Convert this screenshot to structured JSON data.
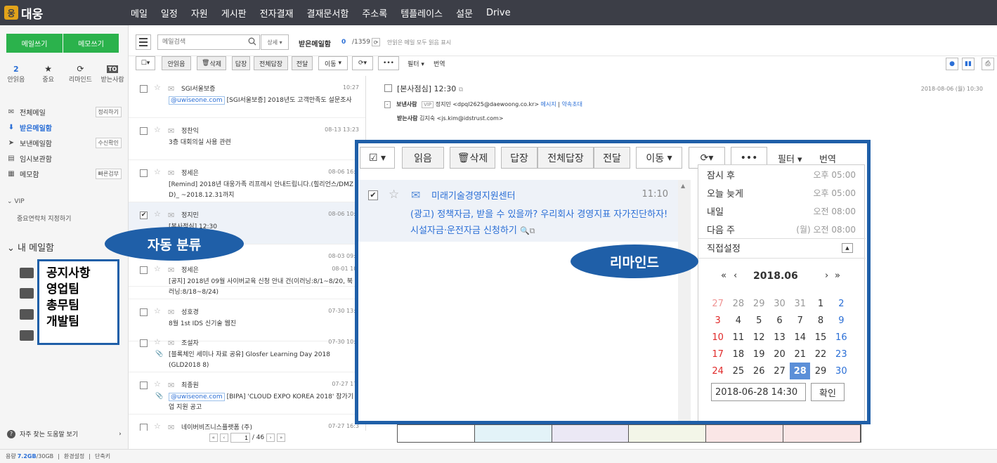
{
  "brand": {
    "logo_mark": "웅",
    "name": "대웅"
  },
  "topnav": [
    "메일",
    "일정",
    "자원",
    "게시판",
    "전자결재",
    "결재문서함",
    "주소록",
    "템플레이스",
    "설문",
    "Drive"
  ],
  "sidebar": {
    "compose": "메일쓰기",
    "memo": "메모쓰기",
    "quick": [
      {
        "top": "2",
        "label": "안읽음"
      },
      {
        "top": "★",
        "label": "중요"
      },
      {
        "top": "⟳",
        "label": "리마인드"
      },
      {
        "top": "TO",
        "label": "받는사람"
      }
    ],
    "folders": [
      {
        "label": "전체메일",
        "icon": "✉",
        "button": "정리하기"
      },
      {
        "label": "받은메일함",
        "icon": "⬇",
        "button": ""
      },
      {
        "label": "보낸메일함",
        "icon": "➤",
        "button": "수신확인"
      },
      {
        "label": "임시보관함",
        "icon": "▤",
        "button": ""
      },
      {
        "label": "메모함",
        "icon": "▦",
        "button": "빠른검부"
      }
    ],
    "vip": "VIP",
    "vip_sub": "중요연락처 지정하기",
    "mybox": "내 메일함",
    "teams": [
      "공지사항",
      "영업팀",
      "총무팀",
      "개발팀"
    ],
    "help": "자주 찾는 도움말 보기"
  },
  "status": {
    "label": "용량",
    "used": "7.2GB",
    "total": "/30GB",
    "settings": "환경설정",
    "shortcut": "단축키"
  },
  "search": {
    "placeholder": "메일검색",
    "detail": "상세",
    "inbox_title": "받은메일함",
    "count": "0",
    "total": "/1359",
    "read_all": "안읽은 메일 모두 읽음 표시"
  },
  "toolbar": {
    "read": "안읽음",
    "delete": "삭제",
    "reply": "답장",
    "reply_all": "전체답장",
    "forward": "전달",
    "move": "이동",
    "more": "•••",
    "filter": "필터",
    "translate": "번역"
  },
  "mails": [
    {
      "sender": "SGI서울보증",
      "date": "10:27",
      "tag": "@uwiseone.com",
      "subject": "[SGI서울보증] 2018년도 고객만족도 설문조사",
      "clip": false,
      "selected": false
    },
    {
      "sender": "정찬익",
      "date": "08-13 13:23",
      "tag": "",
      "subject": "3층 대회의실 사용 관련",
      "clip": false,
      "selected": false
    },
    {
      "sender": "정세은",
      "date": "08-06 16:2",
      "tag": "",
      "subject": "[Remind] 2018년 대웅가족 리프레시 안내드립니다.(힐리언스/DMZ D)_ ~2018.12.31까지",
      "clip": false,
      "selected": false
    },
    {
      "sender": "정지민",
      "date": "08-06 10:3",
      "tag": "",
      "subject": "[본사점심] 12:30",
      "clip": false,
      "selected": true
    },
    {
      "sender": "",
      "date": "08-03 09:3",
      "tag": "",
      "subject": "",
      "clip": false,
      "selected": false
    },
    {
      "sender": "정세은",
      "date": "08-01 10:",
      "tag": "",
      "subject": "[공지] 2018년 09월 사이버교육 신청 안내 건(이러닝:8/1~8/20, 북러닝:8/18~8/24)",
      "clip": false,
      "selected": false
    },
    {
      "sender": "성호경",
      "date": "07-30 13:4",
      "tag": "",
      "subject": "8월 1st IDS 신기술 웹진",
      "clip": false,
      "selected": false
    },
    {
      "sender": "조설자",
      "date": "07-30 10:4",
      "tag": "",
      "subject": "[블록체인 세미나 자료 공유] Glosfer Learning Day 2018 (GLD2018 8)",
      "clip": true,
      "selected": false
    },
    {
      "sender": "최종원",
      "date": "07-27 17:",
      "tag": "@uwiseone.com",
      "subject": "[BIPA] 'CLOUD EXPO KOREA 2018' 참가기업 지원 공고",
      "clip": true,
      "selected": false
    },
    {
      "sender": "네이버비즈니스플랫폼 (주)",
      "date": "07-27 16:3",
      "tag": "",
      "subject": "",
      "clip": false,
      "selected": false
    }
  ],
  "pager": {
    "current": "1",
    "total": "/ 46"
  },
  "reading": {
    "subject": "[본사점심] 12:30",
    "date": "2018-08-06 (월) 10:30",
    "from_label": "보낸사람",
    "vip": "VIP",
    "from": "정지민 <dpql2625@daewoong.co.kr>",
    "from_link1": "메시지",
    "from_link2": "약속초대",
    "to_label": "받는사람",
    "to": "김지숙 <js.kim@idstrust.com>"
  },
  "zoom": {
    "read": "읽음",
    "delete": "삭제",
    "reply": "답장",
    "reply_all": "전체답장",
    "forward": "전달",
    "move": "이동",
    "more": "•••",
    "filter": "필터",
    "translate": "번역",
    "mail_sender": "미래기술경영지원센터",
    "mail_time": "11:10",
    "mail_subject": "(광고) 정책자금, 받을 수 있을까? 우리회사 경영지표 자가진단하자! 시설자금·운전자금 신청하기"
  },
  "remind": {
    "options": [
      {
        "label": "잠시 후",
        "time": "오후 05:00"
      },
      {
        "label": "오늘 늦게",
        "time": "오후 05:00"
      },
      {
        "label": "내일",
        "time": "오전 08:00"
      },
      {
        "label": "다음 주",
        "time": "(월) 오전 08:00"
      }
    ],
    "custom": "직접설정",
    "cal_title": "2018.06",
    "cal_prev2": "«",
    "cal_prev": "‹",
    "cal_next": "›",
    "cal_next2": "»",
    "weeks": [
      [
        "27",
        "28",
        "29",
        "30",
        "31",
        "1",
        "2"
      ],
      [
        "3",
        "4",
        "5",
        "6",
        "7",
        "8",
        "9"
      ],
      [
        "10",
        "11",
        "12",
        "13",
        "14",
        "15",
        "16"
      ],
      [
        "17",
        "18",
        "19",
        "20",
        "21",
        "22",
        "23"
      ],
      [
        "24",
        "25",
        "26",
        "27",
        "28",
        "29",
        "30"
      ]
    ],
    "today": "28",
    "datetime": "2018-06-28 14:30",
    "ok": "확인"
  },
  "callouts": {
    "auto": "자동 분류",
    "remind": "리마인드"
  },
  "colors": {
    "accent": "#1f5fa8",
    "green": "#2bb24c",
    "blue_text": "#2b6fd6",
    "topbar": "#3c3e47"
  },
  "colorbar": [
    "#ffffff",
    "#e3f3f8",
    "#ebe8f5",
    "#f3f6e8",
    "#fae6e6",
    "#fae6e6"
  ]
}
